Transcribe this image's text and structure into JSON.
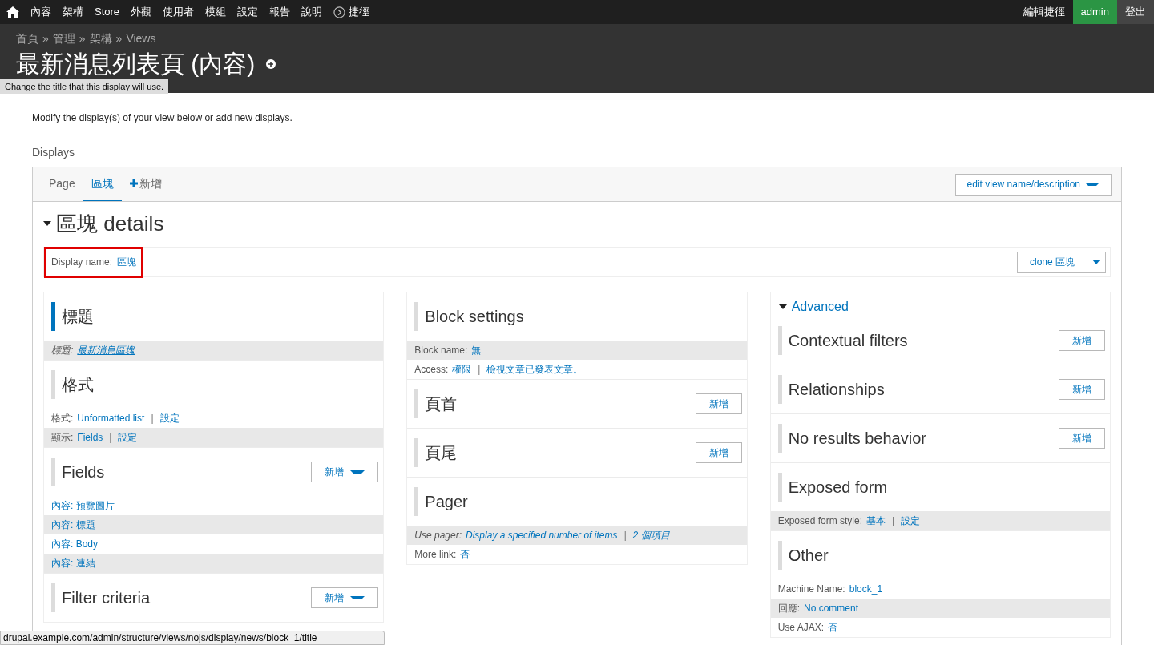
{
  "toolbar": {
    "items": [
      {
        "kind": "home"
      },
      {
        "kind": "link",
        "label": "內容"
      },
      {
        "kind": "link",
        "label": "架構"
      },
      {
        "kind": "link",
        "label": "Store"
      },
      {
        "kind": "link",
        "label": "外觀"
      },
      {
        "kind": "link",
        "label": "使用者"
      },
      {
        "kind": "link",
        "label": "模組"
      },
      {
        "kind": "link",
        "label": "設定"
      },
      {
        "kind": "link",
        "label": "報告"
      },
      {
        "kind": "link",
        "label": "說明"
      },
      {
        "kind": "shortcuts",
        "label": "捷徑"
      }
    ],
    "right": [
      {
        "label": "編輯捷徑",
        "selected": false
      },
      {
        "label": "admin",
        "selected": true
      },
      {
        "label": "登出",
        "selected": false
      }
    ]
  },
  "header": {
    "breadcrumb": [
      "首頁",
      "管理",
      "架構",
      "Views"
    ],
    "breadcrumb_separator": "»",
    "title": "最新消息列表頁 (內容)",
    "tooltip": "Change the title that this display will use."
  },
  "intro": "Modify the display(s) of your view below or add new displays.",
  "displays_label": "Displays",
  "tabs": [
    {
      "kind": "tab",
      "label": "Page",
      "selected": false
    },
    {
      "kind": "tab",
      "label": "區塊",
      "selected": true
    },
    {
      "kind": "add",
      "label": "新增",
      "selected": false
    }
  ],
  "edit_button": "edit view name/description",
  "details": {
    "title": "區塊 details",
    "expanded": true,
    "display_name_label": "Display name:",
    "display_name_value": "區塊",
    "highlighted": true,
    "clone_button": "clone 區塊"
  },
  "link_separator": "|",
  "columns": [
    {
      "sections": [
        {
          "title": "標題",
          "active": true,
          "rows": [
            {
              "label": "標題:",
              "links": [
                "最新消息區塊"
              ],
              "shaded": true,
              "italic": true,
              "underline": true
            }
          ]
        },
        {
          "title": "格式",
          "active": false,
          "rows": [
            {
              "label": "格式:",
              "links": [
                "Unformatted list",
                "設定"
              ],
              "shaded": false
            },
            {
              "label": "顯示:",
              "links": [
                "Fields",
                "設定"
              ],
              "shaded": true
            }
          ]
        },
        {
          "title": "Fields",
          "active": false,
          "button": {
            "label": "新增",
            "dropdown": true
          },
          "rows": [
            {
              "links": [
                "內容: 預覽圖片"
              ],
              "shaded": false
            },
            {
              "links": [
                "內容: 標題"
              ],
              "shaded": true
            },
            {
              "links": [
                "內容: Body"
              ],
              "shaded": false
            },
            {
              "links": [
                "內容: 連結"
              ],
              "shaded": true
            }
          ]
        },
        {
          "title": "Filter criteria",
          "active": false,
          "button": {
            "label": "新增",
            "dropdown": true
          }
        }
      ]
    },
    {
      "sections": [
        {
          "title": "Block settings",
          "active": false,
          "rows": [
            {
              "label": "Block name:",
              "links": [
                "無"
              ],
              "shaded": true
            },
            {
              "label": "Access:",
              "links": [
                "權限",
                "檢視文章已發表文章。"
              ],
              "shaded": false
            }
          ]
        },
        {
          "title": "頁首",
          "active": false,
          "button": {
            "label": "新增",
            "dropdown": false
          }
        },
        {
          "title": "頁尾",
          "active": false,
          "button": {
            "label": "新增",
            "dropdown": false
          }
        },
        {
          "title": "Pager",
          "active": false,
          "rows": [
            {
              "label": "Use pager:",
              "links": [
                "Display a specified number of items",
                "2 個項目"
              ],
              "shaded": true,
              "italic": true
            },
            {
              "label": "More link:",
              "links": [
                "否"
              ],
              "shaded": false
            }
          ]
        }
      ]
    },
    {
      "advanced": {
        "label": "Advanced",
        "expanded": true
      },
      "sections": [
        {
          "title": "Contextual filters",
          "active": false,
          "button": {
            "label": "新增",
            "dropdown": false
          }
        },
        {
          "title": "Relationships",
          "active": false,
          "button": {
            "label": "新增",
            "dropdown": false
          }
        },
        {
          "title": "No results behavior",
          "active": false,
          "button": {
            "label": "新增",
            "dropdown": false
          }
        },
        {
          "title": "Exposed form",
          "active": false,
          "rows": [
            {
              "label": "Exposed form style:",
              "links": [
                "基本",
                "設定"
              ],
              "shaded": true
            }
          ]
        },
        {
          "title": "Other",
          "active": false,
          "rows": [
            {
              "label": "Machine Name:",
              "links": [
                "block_1"
              ],
              "shaded": false
            },
            {
              "label": "回應:",
              "links": [
                "No comment"
              ],
              "shaded": true
            },
            {
              "label": "Use AJAX:",
              "links": [
                "否"
              ],
              "shaded": false
            }
          ]
        }
      ]
    }
  ],
  "status_url": "drupal.example.com/admin/structure/views/nojs/display/news/block_1/title"
}
